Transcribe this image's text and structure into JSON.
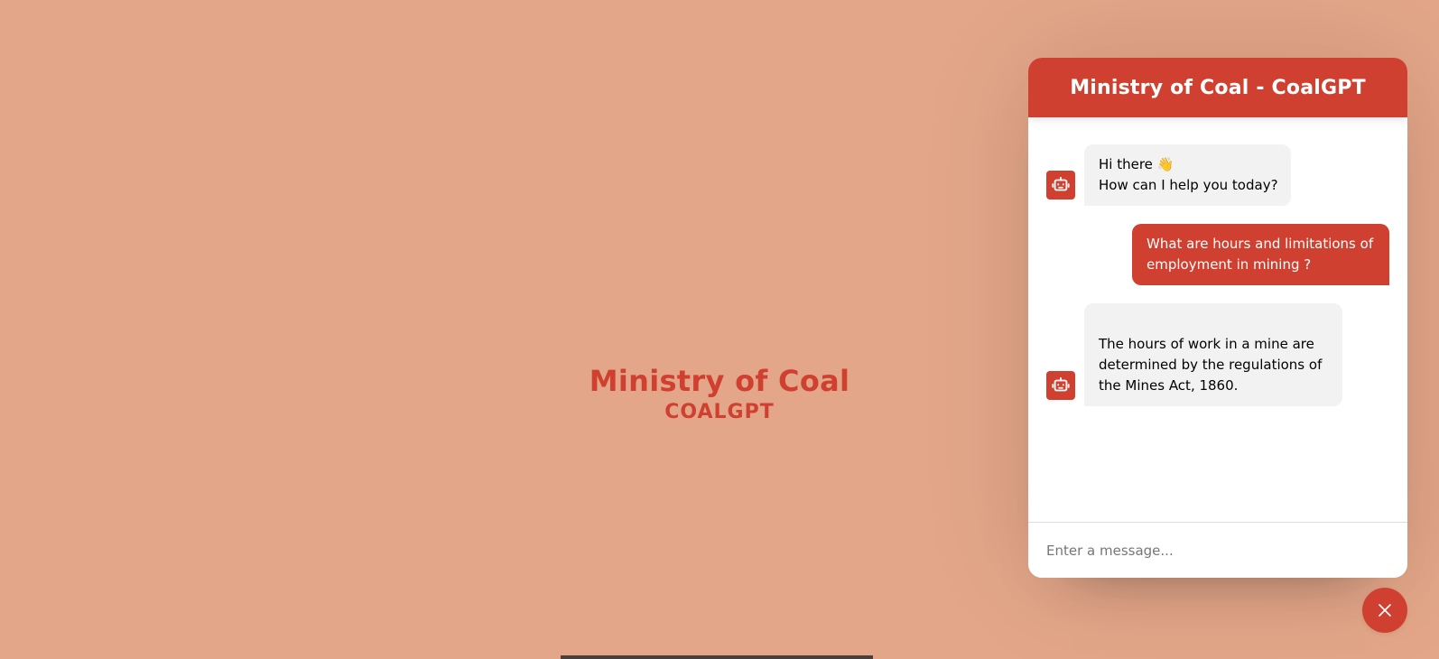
{
  "hero": {
    "title": "Ministry of Coal",
    "subtitle": "COALGPT"
  },
  "chatbot": {
    "header_title": "Ministry of Coal - CoalGPT",
    "messages": [
      {
        "role": "incoming",
        "avatar_icon": "robot-icon",
        "lines": [
          "Hi there 👋",
          "How can I help you today?"
        ]
      },
      {
        "role": "outgoing",
        "lines": [
          "What are hours and limitations of",
          "employment in mining ?"
        ]
      },
      {
        "role": "incoming",
        "avatar_icon": "robot-icon",
        "lines": [
          "The hours of work in a mine are",
          "determined by the regulations of",
          "the Mines Act, 1860."
        ]
      }
    ],
    "input": {
      "placeholder": "Enter a message...",
      "value": ""
    },
    "toggler_icon": "close-icon"
  },
  "colors": {
    "background": "#e3a689",
    "accent": "#d04030",
    "incoming_bubble": "#f2f2f2"
  }
}
